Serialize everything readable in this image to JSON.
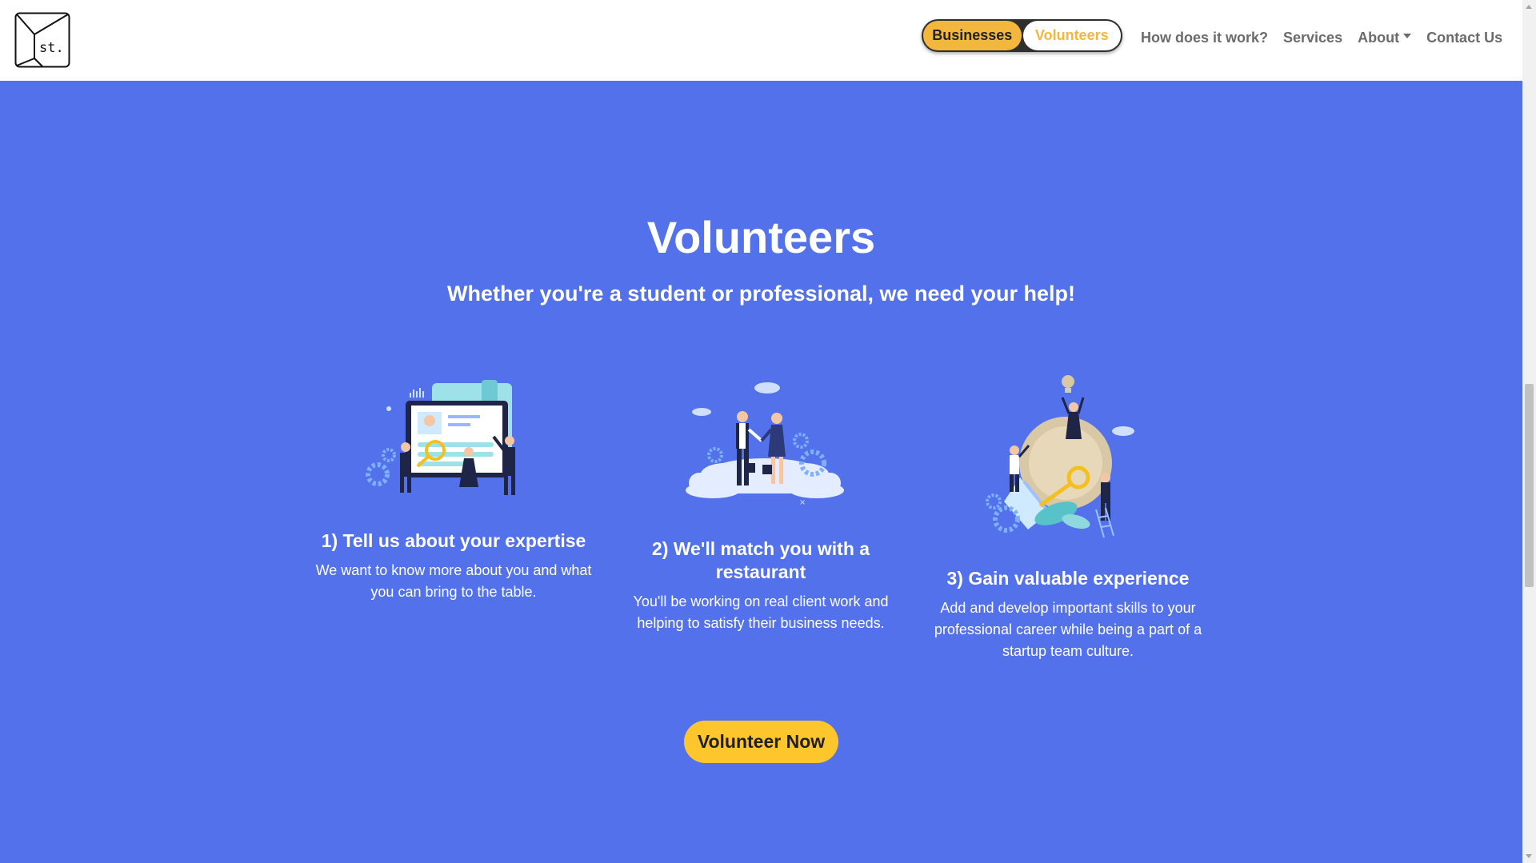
{
  "header": {
    "logo_text": "st.",
    "toggle": {
      "businesses": "Businesses",
      "volunteers": "Volunteers",
      "active": "volunteers"
    },
    "nav": [
      "How does it work?",
      "Services",
      "About",
      "Contact Us"
    ]
  },
  "hero": {
    "title": "Volunteers",
    "subtitle": "Whether you're a student or professional, we need your help!"
  },
  "steps": [
    {
      "title": "1) Tell us about your expertise",
      "text": "We want to know more about you and what you can bring to the table.",
      "illustration": "resume-review-illustration"
    },
    {
      "title": "2) We'll match you with a restaurant",
      "text": "You'll be working on real client work and helping to satisfy their business needs.",
      "illustration": "handshake-illustration"
    },
    {
      "title": "3) Gain valuable experience",
      "text": "Add and develop important skills to your professional career while being a part of a startup team culture.",
      "illustration": "lightbulb-team-illustration"
    }
  ],
  "cta": {
    "label": "Volunteer Now"
  },
  "colors": {
    "background": "#5271ea",
    "accent": "#fec62d",
    "toggle_active": "#f4b73d",
    "nav_text": "#6b6b6b"
  }
}
